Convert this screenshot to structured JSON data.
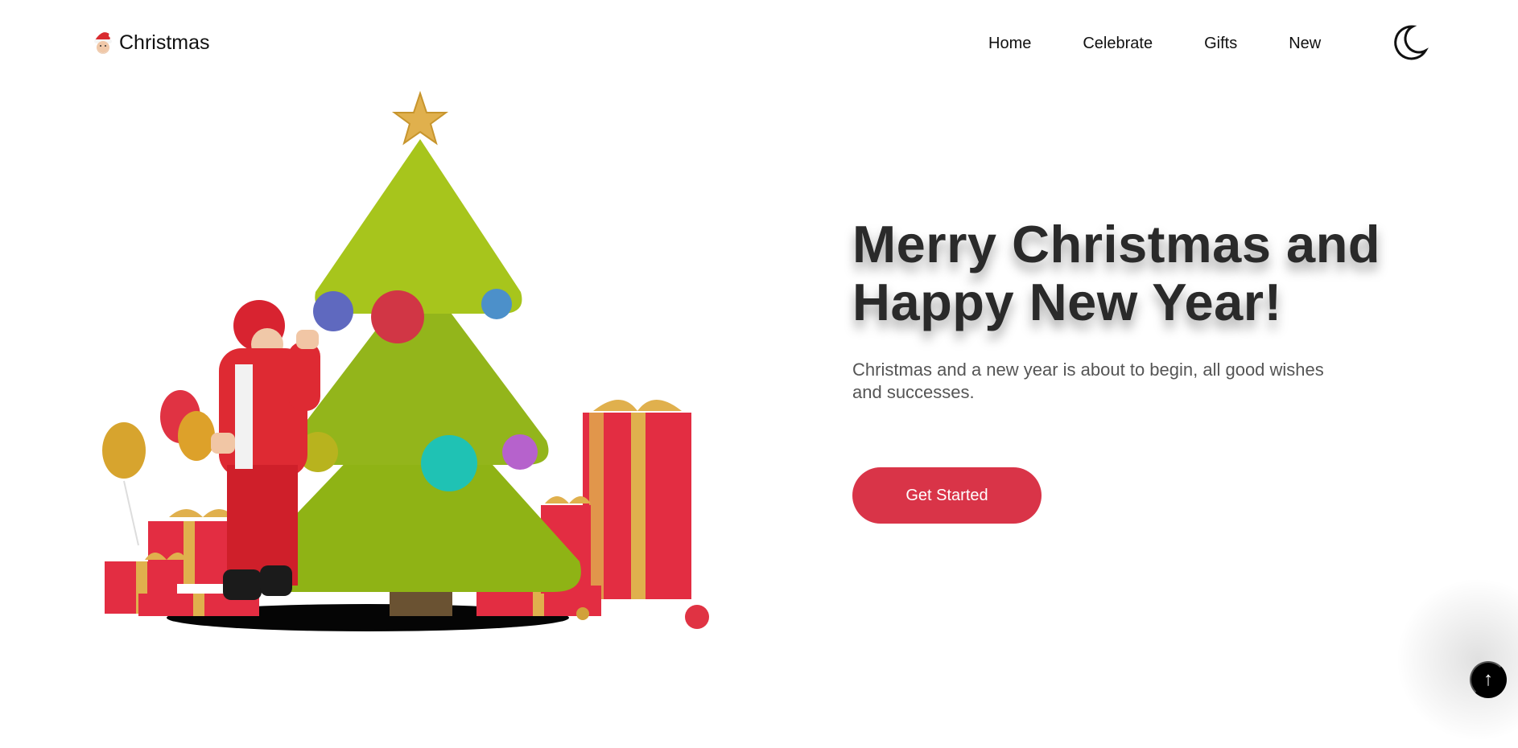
{
  "header": {
    "logo_text": "Christmas",
    "logo_icon": "santa-head-icon",
    "nav": [
      {
        "label": "Home"
      },
      {
        "label": "Celebrate"
      },
      {
        "label": "Gifts"
      },
      {
        "label": "New"
      }
    ],
    "theme_icon": "moon-icon"
  },
  "hero": {
    "title_line1": "Merry Christmas and",
    "title_line2": "Happy New Year!",
    "description": "Christmas and a new year is about to begin, all good wishes and successes.",
    "cta_label": "Get Started",
    "illustration_icon": "santa-tree-gifts-illustration"
  },
  "scroll_top": {
    "icon": "arrow-up-icon",
    "glyph": "↑"
  },
  "colors": {
    "accent": "#d93448",
    "tree": "#93b51b",
    "gift": "#e32d42",
    "gold": "#e0b04d",
    "text": "#2a2a2a"
  }
}
